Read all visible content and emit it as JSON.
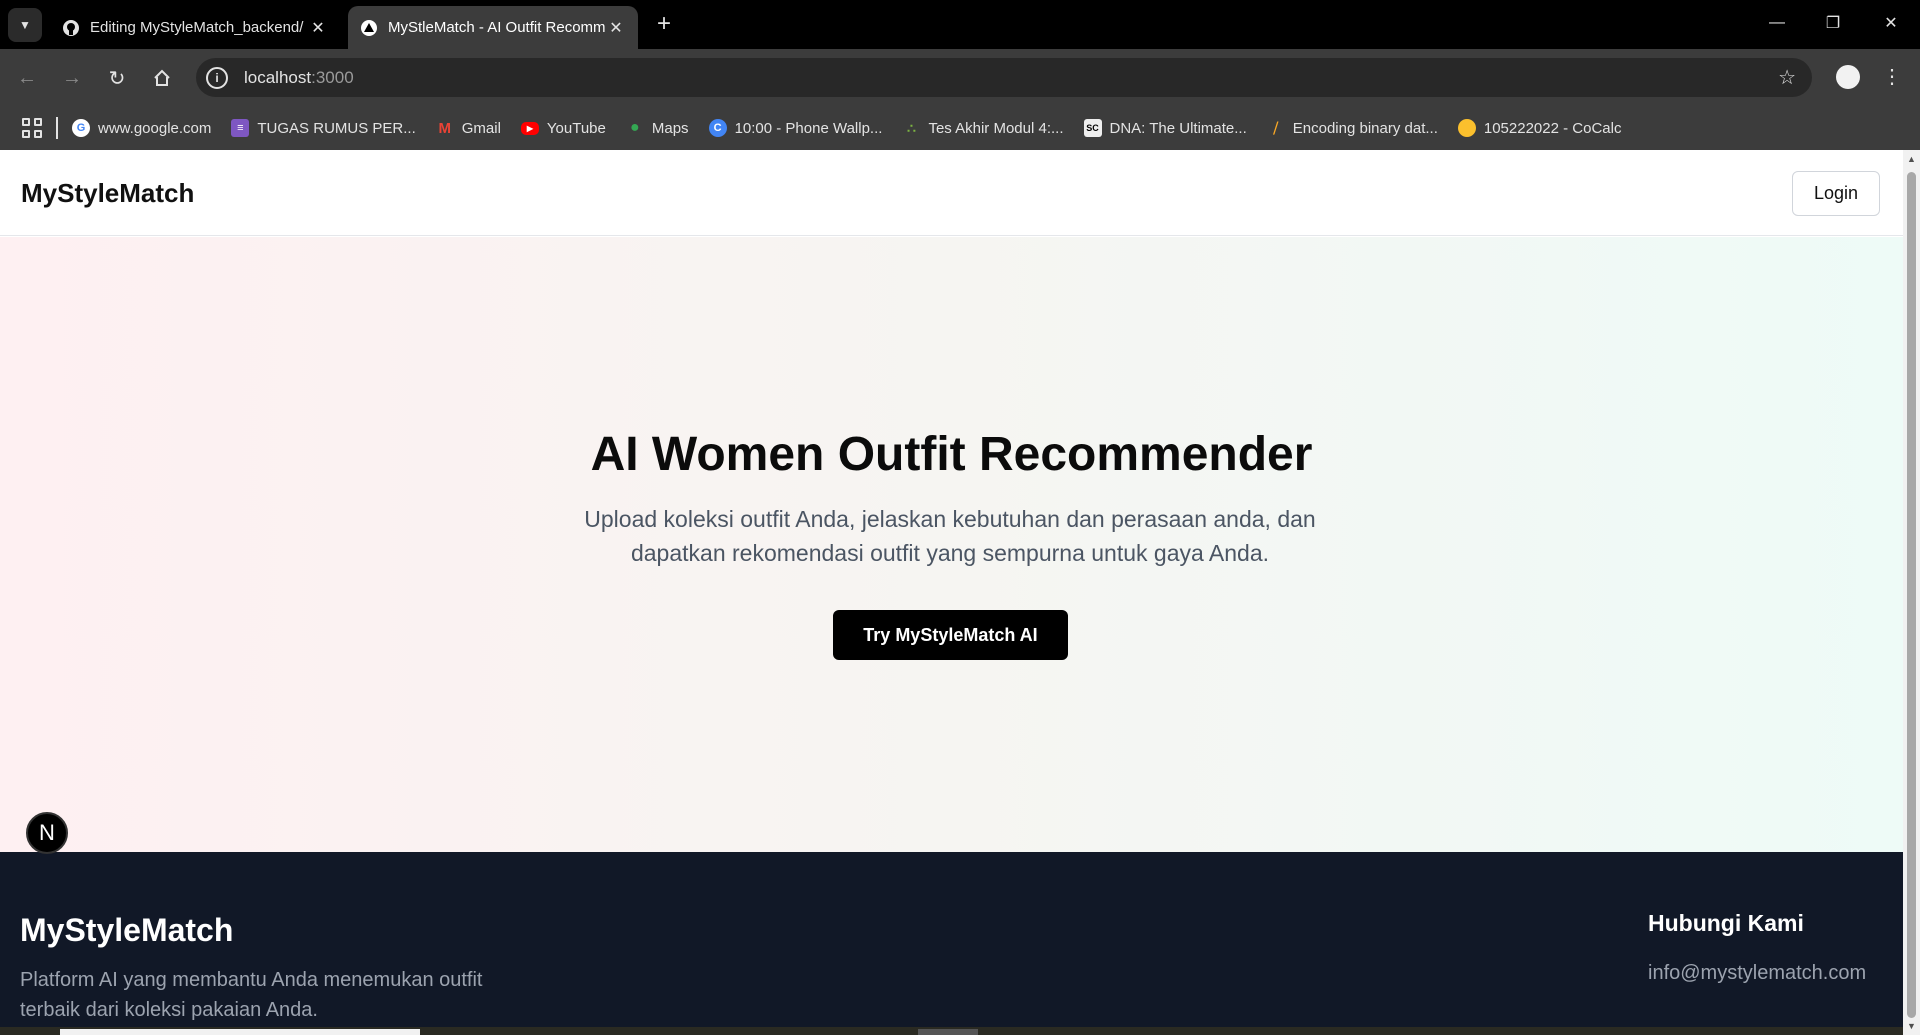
{
  "browser": {
    "tabs": [
      {
        "title": "Editing MyStyleMatch_backend/",
        "active": false,
        "icon": "github-icon"
      },
      {
        "title": "MyStleMatch - AI Outfit Recomm",
        "active": true,
        "icon": "nextjs-triangle-icon"
      }
    ],
    "address": {
      "host": "localhost",
      "port": ":3000"
    },
    "bookmarks": [
      {
        "label": "www.google.com",
        "icon": "google-icon",
        "color": "#ffffff"
      },
      {
        "label": "TUGAS RUMUS PER...",
        "icon": "forms-icon",
        "color": "#7e57c2"
      },
      {
        "label": "Gmail",
        "icon": "gmail-icon",
        "color": "#ea4335"
      },
      {
        "label": "YouTube",
        "icon": "youtube-icon",
        "color": "#ff0000"
      },
      {
        "label": "Maps",
        "icon": "maps-icon",
        "color": "#34a853"
      },
      {
        "label": "10:00 - Phone Wallp...",
        "icon": "wallpaper-icon",
        "color": "#4285f4"
      },
      {
        "label": "Tes Akhir Modul 4:...",
        "icon": "dots-icon",
        "color": "#7cb342"
      },
      {
        "label": "DNA: The Ultimate...",
        "icon": "dna-icon",
        "color": "#eeeeee"
      },
      {
        "label": "Encoding binary dat...",
        "icon": "stripes-icon",
        "color": "#f9a825"
      },
      {
        "label": "105222022 - CoCalc",
        "icon": "cocalc-icon",
        "color": "#fbc02d"
      }
    ]
  },
  "site": {
    "header": {
      "logo": "MyStyleMatch",
      "login_label": "Login"
    },
    "hero": {
      "title": "AI Women Outfit Recommender",
      "subtitle": "Upload koleksi outfit Anda, jelaskan kebutuhan dan perasaan anda, dan dapatkan rekomendasi outfit yang sempurna untuk gaya Anda.",
      "cta_label": "Try MyStyleMatch AI"
    },
    "footer": {
      "logo": "MyStyleMatch",
      "description": "Platform AI yang membantu Anda menemukan outfit terbaik dari koleksi pakaian Anda.",
      "contact_title": "Hubungi Kami",
      "email": "info@mystylematch.com"
    },
    "next_badge": "N"
  },
  "colors": {
    "hero_left": "#fef0f2",
    "hero_right": "#eefbf7",
    "footer_bg": "#111827",
    "cta_bg": "#000000"
  }
}
